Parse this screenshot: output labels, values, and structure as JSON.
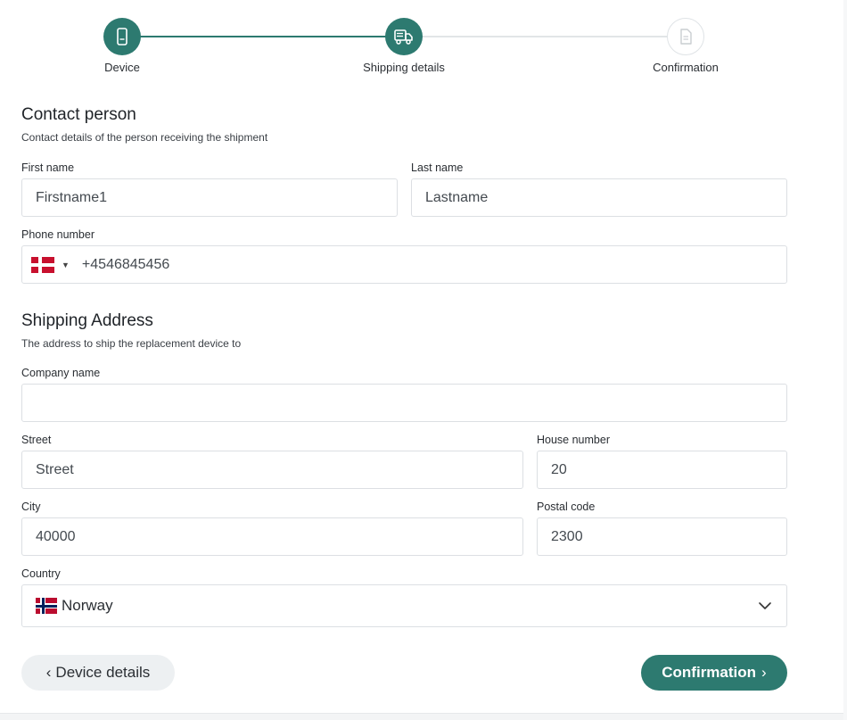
{
  "stepper": {
    "steps": [
      {
        "label": "Device",
        "state": "done",
        "icon": "phone-icon"
      },
      {
        "label": "Shipping details",
        "state": "current",
        "icon": "truck-icon"
      },
      {
        "label": "Confirmation",
        "state": "todo",
        "icon": "document-icon"
      }
    ]
  },
  "contact": {
    "title": "Contact person",
    "subtitle": "Contact details of the person receiving the shipment",
    "first_name_label": "First name",
    "first_name_value": "Firstname1",
    "last_name_label": "Last name",
    "last_name_value": "Lastname",
    "phone_label": "Phone number",
    "phone_value": "+4546845456",
    "phone_country_flag": "denmark-flag-icon"
  },
  "shipping": {
    "title": "Shipping Address",
    "subtitle": "The address to ship the replacement device to",
    "company_label": "Company name",
    "company_value": "",
    "street_label": "Street",
    "street_value": "Street",
    "house_label": "House number",
    "house_value": "20",
    "city_label": "City",
    "city_value": "40000",
    "postal_label": "Postal code",
    "postal_value": "2300",
    "country_label": "Country",
    "country_value": "Norway",
    "country_flag": "norway-flag-icon"
  },
  "nav": {
    "back_label": "Device details",
    "next_label": "Confirmation"
  },
  "colors": {
    "accent": "#2d7a70",
    "back_button_bg": "#edf0f2",
    "input_border": "#dcdfe3"
  }
}
